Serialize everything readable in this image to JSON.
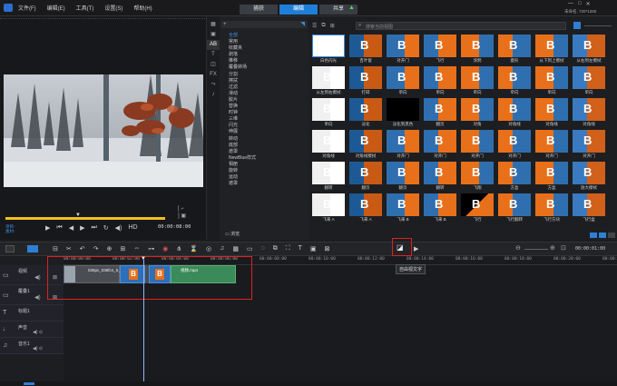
{
  "menu": [
    "文件(F)",
    "编辑(E)",
    "工具(T)",
    "设置(S)",
    "帮助(H)"
  ],
  "tabs": [
    {
      "label": "捕获",
      "active": false
    },
    {
      "label": "编辑",
      "active": true
    },
    {
      "label": "共享",
      "active": false
    }
  ],
  "project_info": "未命名, 720*1280",
  "preview": {
    "timecode": "00:00:08:00",
    "labels": [
      "项目-",
      "素材-"
    ]
  },
  "search": {
    "placeholder": "搜索当前视图"
  },
  "library": {
    "categories": [
      "全部",
      "常用",
      "收藏夹",
      "剥落",
      "推移",
      "覆叠转场",
      "分割",
      "擦拭",
      "过滤",
      "滑动",
      "胶片",
      "替换",
      "时钟",
      "三维",
      "闪光",
      "伸展",
      "转动",
      "底部",
      "遮罩",
      "NewBlue样式",
      "相册",
      "旋转",
      "运动",
      "遮罩"
    ],
    "browse_label": "浏览"
  },
  "transitions": [
    "白色闪光",
    "百叶窗",
    "对开门",
    "飞行",
    "涂鸦",
    "菱形",
    "从下到上擦拭",
    "从右到左擦拭",
    "从左到右擦拭",
    "打碎",
    "单向",
    "单向",
    "单向",
    "单向",
    "单向",
    "单向",
    "单向",
    "淡化",
    "淡化到黑色",
    "翻页",
    "对角",
    "对角线",
    "对角线",
    "对角线",
    "对角线",
    "对角线擦拭",
    "对开门",
    "对开门",
    "对开门",
    "对开门",
    "对开门",
    "对开门",
    "翻转",
    "翻页",
    "翻页",
    "翻转",
    "飞翔",
    "方盒",
    "方盒",
    "放大擦拭",
    "飞来 A",
    "飞来 A",
    "飞来 B",
    "飞来 B",
    "飞行",
    "飞行翻转",
    "飞行方块",
    "飞行盒"
  ],
  "toolbar_tooltip": "自由视文字",
  "timeline": {
    "ruler": [
      "00:00:00:00",
      "00:00:02:00",
      "00:00:04:00",
      "00:00:06:00",
      "00:00:08:00",
      "00:00:10:00",
      "00:00:12:00",
      "00:00:14:00",
      "00:00:16:00",
      "00:00:18:00",
      "00:00:20:00",
      "00:00:2"
    ],
    "zoom_timecode": "00:00:01:00",
    "tracks": [
      "视频",
      "覆叠1",
      "标题1",
      "声音",
      "音乐1"
    ],
    "clips": [
      {
        "label": "036pc_036fcn_5_1_...",
        "track": "视频"
      },
      {
        "label": "视频.mp4",
        "track": "视频"
      }
    ]
  },
  "colors": {
    "accent": "#1e7fd8",
    "highlight_red": "#e02020",
    "clip_green": "#3a8a5a"
  }
}
